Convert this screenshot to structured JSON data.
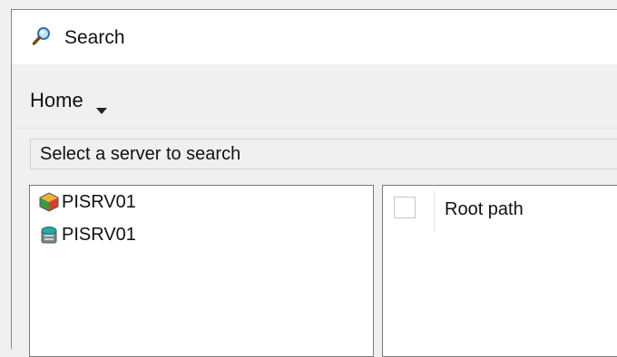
{
  "window": {
    "title": "Search",
    "title_icon": "magnifier-icon"
  },
  "menu": {
    "home_label": "Home",
    "home_icon": "chevron-down-icon"
  },
  "server_bar": {
    "text": "Select a server to search"
  },
  "tree": {
    "items": [
      {
        "label": "PISRV01",
        "icon": "af-server-icon"
      },
      {
        "label": "PISRV01",
        "icon": "data-archive-icon"
      }
    ]
  },
  "results": {
    "columns": [
      {
        "label": "Root path"
      }
    ]
  },
  "colors": {
    "window_border": "#5b8fd6",
    "title_background": "#ffffff",
    "chrome_background": "#f0f0f0",
    "panel_border": "#7a7a7a"
  }
}
